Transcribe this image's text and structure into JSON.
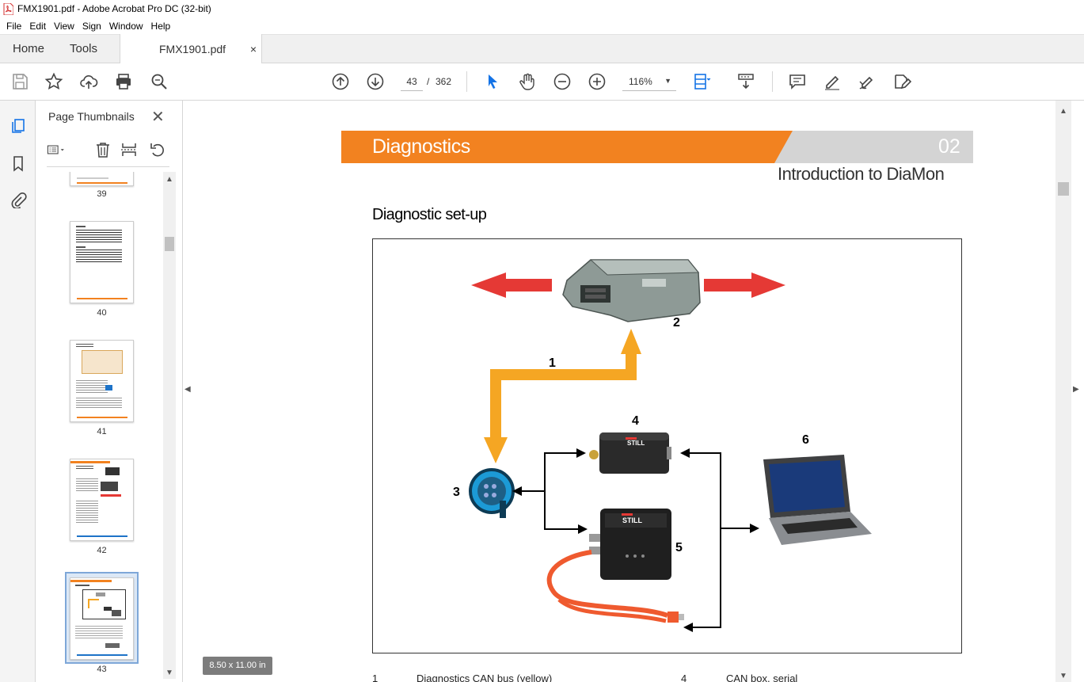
{
  "window": {
    "title": "FMX1901.pdf - Adobe Acrobat Pro DC (32-bit)"
  },
  "menu": [
    "File",
    "Edit",
    "View",
    "Sign",
    "Window",
    "Help"
  ],
  "tabs": {
    "home": "Home",
    "tools": "Tools",
    "document": "FMX1901.pdf",
    "close_glyph": "×"
  },
  "toolbar": {
    "current_page": "43",
    "page_separator": "/",
    "total_pages": "362",
    "zoom": "116%"
  },
  "sidebar": {
    "title": "Page Thumbnails",
    "close_glyph": "✕",
    "thumbnails": [
      {
        "label": "39"
      },
      {
        "label": "40"
      },
      {
        "label": "41"
      },
      {
        "label": "42"
      },
      {
        "label": "43",
        "selected": true
      }
    ]
  },
  "document": {
    "banner_title": "Diagnostics",
    "banner_number": "02",
    "subtitle": "Introduction to DiaMon",
    "section_heading": "Diagnostic set-up",
    "figure_labels": [
      "1",
      "2",
      "3",
      "4",
      "5",
      "6"
    ],
    "legend": [
      {
        "num": "1",
        "text": "Diagnostics CAN bus (yellow)"
      },
      {
        "num": "4",
        "text": "CAN box, serial"
      }
    ],
    "brand_text": "STILL"
  },
  "status": {
    "page_size": "8.50 x 11.00 in"
  },
  "colors": {
    "banner_orange": "#f28220",
    "banner_grey": "#d4d4d4",
    "arrow_red": "#e53935",
    "arrow_yellow": "#f5a623",
    "accent_blue": "#1473e6"
  }
}
